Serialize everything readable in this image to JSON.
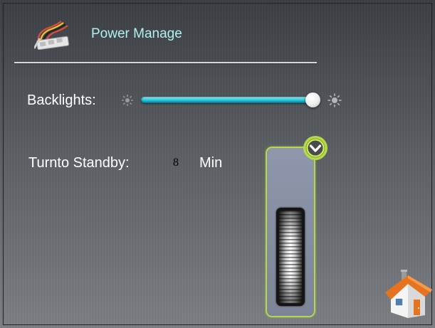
{
  "header": {
    "title": "Power Manage",
    "icon": "cable-connector-icon"
  },
  "backlight": {
    "label": "Backlights:",
    "level_percent": 100,
    "min_icon": "brightness-low-icon",
    "max_icon": "brightness-high-icon",
    "accent_color": "#22cbe0"
  },
  "standby": {
    "label": "Turnto Standby:",
    "value": "8",
    "unit": "Min"
  },
  "wheel_picker": {
    "confirm_icon": "chevron-down-circle-icon",
    "border_color": "#b4d84a"
  },
  "home": {
    "icon": "home-icon"
  }
}
